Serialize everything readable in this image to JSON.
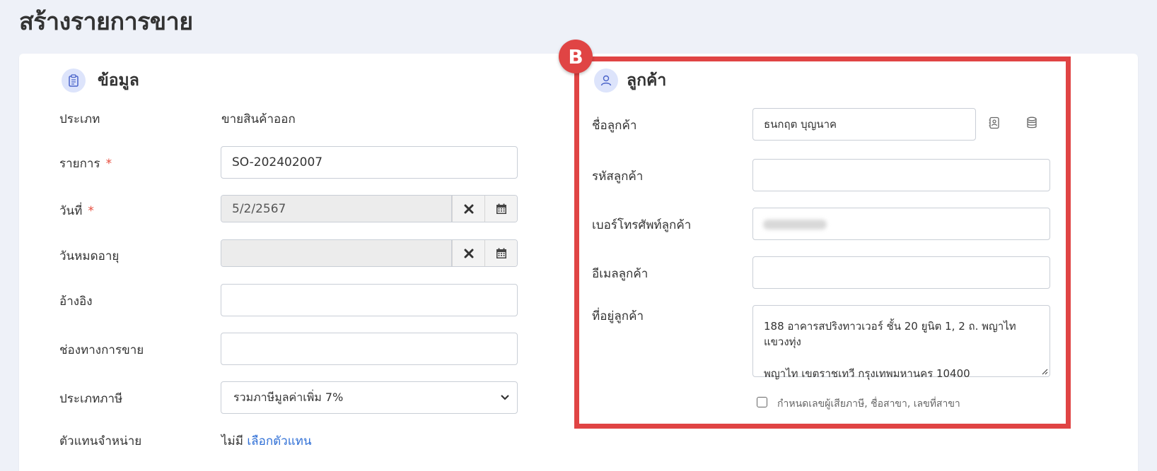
{
  "page": {
    "title": "สร้างรายการขาย"
  },
  "info_section": {
    "title": "ข้อมูล",
    "icon": "clipboard-icon",
    "type_label": "ประเภท",
    "type_value": "ขายสินค้าออก",
    "doc_label": "รายการ",
    "doc_required": "*",
    "doc_value": "SO-202402007",
    "date_label": "วันที่",
    "date_required": "*",
    "date_value": "5/2/2567",
    "expire_label": "วันหมดอายุ",
    "expire_value": "",
    "ref_label": "อ้างอิง",
    "ref_value": "",
    "channel_label": "ช่องทางการขาย",
    "channel_value": "",
    "tax_label": "ประเภทภาษี",
    "tax_value": "รวมภาษีมูลค่าเพิ่ม 7%",
    "agent_label": "ตัวแทนจำหน่าย",
    "agent_value": "ไม่มี",
    "agent_link": "เลือกตัวแทน"
  },
  "customer_section": {
    "badge": "B",
    "title": "ลูกค้า",
    "icon": "user-icon",
    "name_label": "ชื่อลูกค้า",
    "name_value": "ธนกฤต บุญนาค",
    "code_label": "รหัสลูกค้า",
    "code_value": "",
    "phone_label": "เบอร์โทรศัพท์ลูกค้า",
    "email_label": "อีเมลลูกค้า",
    "email_value": "",
    "address_label": "ที่อยู่ลูกค้า",
    "address_line1": "188 อาคารสปริงทาวเวอร์ ชั้น 20 ยูนิต 1, 2 ถ. พญาไท แขวงทุ่ง",
    "address_line2": "พญาไท เขตราชเทวี กรุงเทพมหานคร 10400",
    "tax_checkbox_label": "กำหนดเลขผู้เสียภาษี, ชื่อสาขา, เลขที่สาขา"
  },
  "colors": {
    "accent_red": "#e04444",
    "link_blue": "#2f6fd6",
    "icon_bg": "#dde4fb",
    "page_bg": "#eef1f8"
  }
}
